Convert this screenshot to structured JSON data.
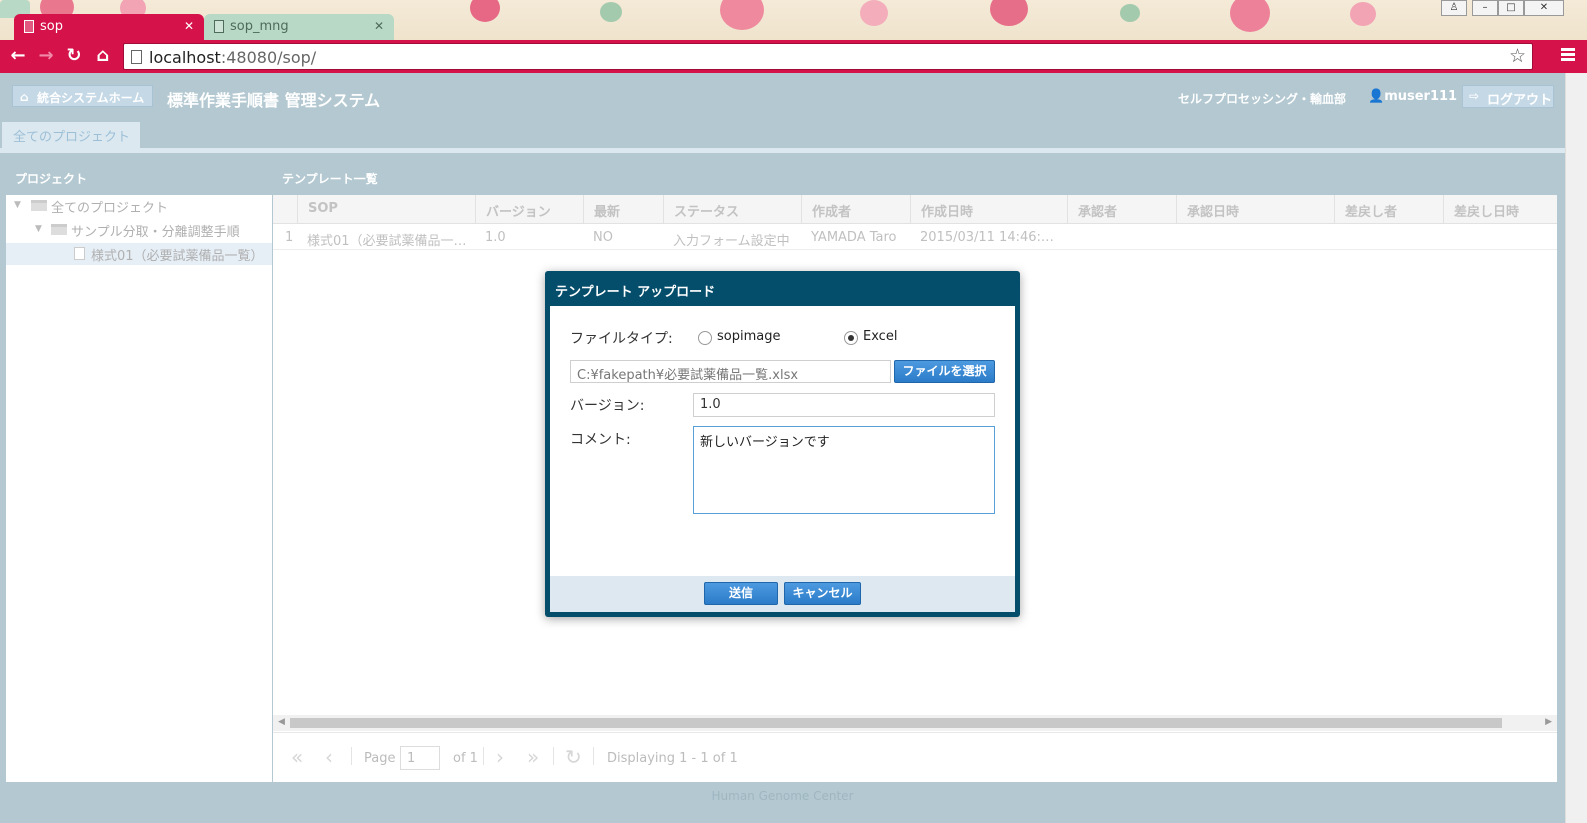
{
  "browser": {
    "tabs": [
      {
        "title": "sop",
        "active": true
      },
      {
        "title": "sop_mng",
        "active": false
      }
    ],
    "url_host": "localhost",
    "url_rest": ":48080/sop/",
    "accent": "#d5124a"
  },
  "header": {
    "home_label": "統合システムホーム",
    "app_title": "標準作業手順書 管理システム",
    "department": "セルフプロセッシング・輸血部",
    "user": "muser111",
    "logout_label": "ログアウト"
  },
  "tabs": {
    "all_projects": "全てのプロジェクト"
  },
  "left_panel": {
    "title": "プロジェクト",
    "tree": [
      {
        "label": "全てのプロジェクト",
        "type": "folder",
        "level": 0
      },
      {
        "label": "サンプル分取・分離調整手順",
        "type": "folder",
        "level": 1
      },
      {
        "label": "様式01（必要試薬備品一覧）",
        "type": "file",
        "level": 2,
        "selected": true
      }
    ]
  },
  "grid": {
    "title": "テンプレート一覧",
    "columns": [
      "SOP",
      "バージョン",
      "最新",
      "ステータス",
      "作成者",
      "作成日時",
      "承認者",
      "承認日時",
      "差戻し者",
      "差戻し日時"
    ],
    "rows": [
      {
        "num": "1",
        "sop": "様式01（必要試薬備品一…",
        "version": "1.0",
        "latest": "NO",
        "status": "入力フォーム設定中",
        "creator": "YAMADA Taro",
        "created": "2015/03/11 14:46:…",
        "approver": "",
        "approved": "",
        "rejector": "",
        "rejected": ""
      }
    ]
  },
  "pager": {
    "page_label": "Page",
    "page_value": "1",
    "of_label": "of 1",
    "displaying": "Displaying 1 - 1 of 1"
  },
  "footer": "Human Genome Center",
  "dialog": {
    "title": "テンプレート アップロード",
    "file_type_label": "ファイルタイプ:",
    "radio_options": [
      {
        "label": "sopimage",
        "checked": false
      },
      {
        "label": "Excel",
        "checked": true
      }
    ],
    "file_path": "C:¥fakepath¥必要試薬備品一覧.xlsx",
    "choose_file_label": "ファイルを選択",
    "version_label": "バージョン:",
    "version_value": "1.0",
    "comment_label": "コメント:",
    "comment_value": "新しいバージョンです",
    "submit_label": "送信",
    "cancel_label": "キャンセル"
  }
}
